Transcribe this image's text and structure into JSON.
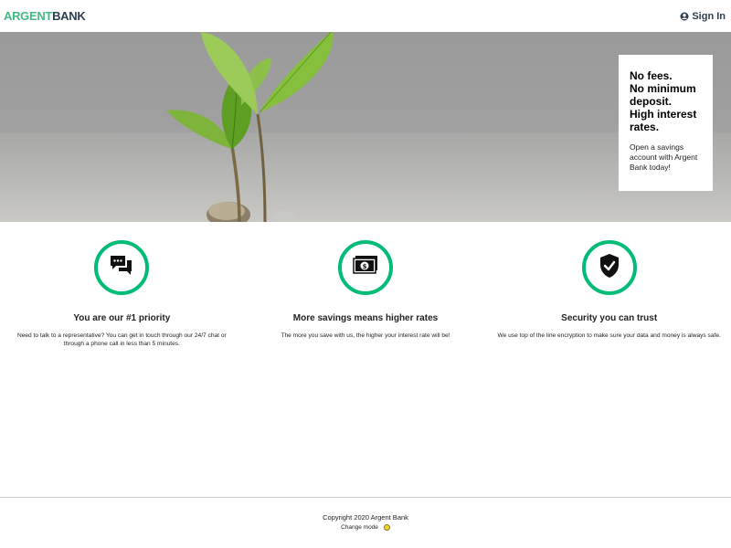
{
  "nav": {
    "logo_part1": "ARGENT",
    "logo_part2": "BANK",
    "signin_label": "Sign In",
    "signin_icon": "user-circle-icon",
    "brand_color": "#42b983"
  },
  "hero": {
    "subtitles": [
      "No fees.",
      "No minimum deposit.",
      "High interest rates."
    ],
    "text": "Open a savings account with Argent Bank today!"
  },
  "features": [
    {
      "icon": "chat-icon",
      "title": "You are our #1 priority",
      "description": "Need to talk to a representative? You can get in touch through our 24/7 chat or through a phone call in less than 5 minutes."
    },
    {
      "icon": "money-icon",
      "title": "More savings means higher rates",
      "description": "The more you save with us, the higher your interest rate will be!"
    },
    {
      "icon": "security-shield-icon",
      "title": "Security you can trust",
      "description": "We use top of the line encryption to make sure your data and money is always safe."
    }
  ],
  "footer": {
    "copyright": "Copyright 2020 Argent Bank",
    "change_mode_label": "Change mode",
    "accent_color": "#00bc77"
  }
}
